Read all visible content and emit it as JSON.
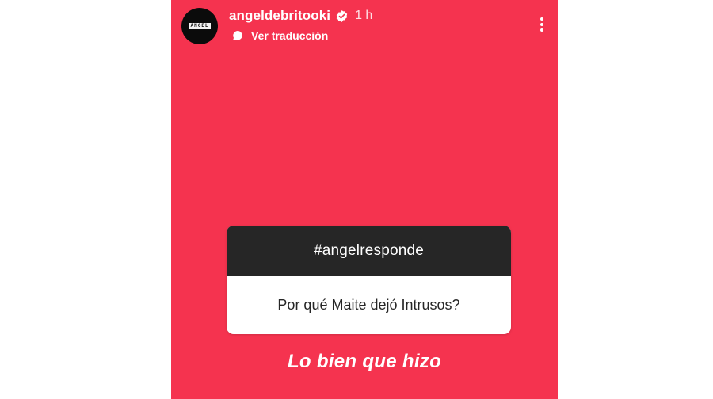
{
  "colors": {
    "story_background": "#f5334f",
    "question_header": "#262626",
    "text_light": "#ffffff"
  },
  "story": {
    "avatar_text": "ANGEL",
    "username": "angeldebritooki",
    "verified_icon": "verified-badge-icon",
    "time": "1 h",
    "translation_icon": "speech-bubble-icon",
    "translation_label": "Ver traducción",
    "more_icon": "more-vertical-icon"
  },
  "question_sticker": {
    "title": "#angelresponde",
    "question": "Por qué Maite dejó Intrusos?"
  },
  "answer": "Lo bien que hizo"
}
